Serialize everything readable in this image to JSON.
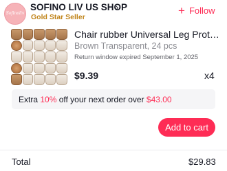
{
  "store": {
    "logo_text": "Sofinoliv",
    "name": "SOFINO LIV US SHOP",
    "chevron": "›",
    "badge": "Gold Star Seller",
    "follow_label": "Follow",
    "follow_icon": "plus-icon"
  },
  "product": {
    "title": "Chair rubber Universal Leg Protector...",
    "variant": "Brown Transparent, 24 pcs",
    "return_note": "Return window expired September 1, 2025",
    "price": "$9.39",
    "quantity": "x4"
  },
  "promo": {
    "prefix": "Extra ",
    "discount": "10%",
    "middle": " off your next order over ",
    "threshold": "$43.00"
  },
  "cart_button": {
    "label": "Add to cart"
  },
  "summary": {
    "total_label": "Total",
    "total_value": "$29.83"
  },
  "colors": {
    "accent": "#fe2c55",
    "badge_gold": "#c0841a",
    "muted_text": "#8a8b91",
    "banner_bg": "#f5f5f7"
  }
}
